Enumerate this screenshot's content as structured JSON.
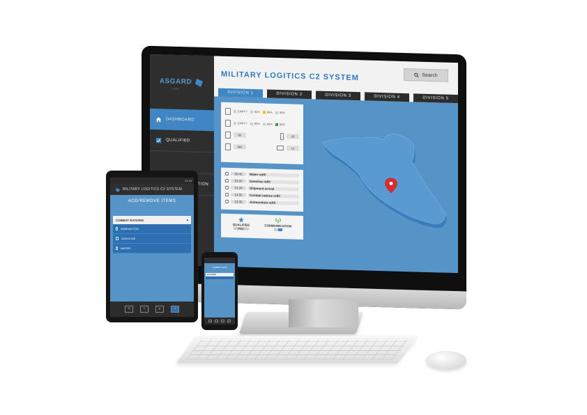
{
  "desktop": {
    "logo": {
      "name": "ASGARD",
      "sub": "LOGI"
    },
    "sidebar": [
      {
        "label": "DASHBOARD",
        "icon": "home-icon",
        "active": true
      },
      {
        "label": "QUALIFIED",
        "icon": "checkbox-icon",
        "active": false
      },
      {
        "label": "",
        "icon": "",
        "active": false
      },
      {
        "label": "ATION",
        "icon": "",
        "active": false
      },
      {
        "label": "",
        "icon": "",
        "active": false
      }
    ],
    "title": "MILITARY LOGITICS C2 SYSTEM",
    "search_label": "Search",
    "tabs": [
      "DIVISION 1",
      "DIVISION 2",
      "DIVISION 3",
      "DIVISION 4",
      "DIVISION 5"
    ],
    "supply": {
      "row1": {
        "empty": "EMPTY",
        "a": "50%",
        "b": "80%",
        "c": "90%"
      },
      "row2": {
        "empty": "EMPTY",
        "a": "90%",
        "b": "90%",
        "c": "80%"
      },
      "row3": {
        "left": "90",
        "right": "25"
      },
      "row4": {
        "left": "682",
        "right": "12"
      }
    },
    "events": [
      {
        "time": "20:45",
        "label": "Water refill"
      },
      {
        "time": "15:20",
        "label": "Gasoline refill"
      },
      {
        "time": "15:20",
        "label": "Shipment arrival"
      },
      {
        "time": "14:35",
        "label": "Combat rations refill"
      },
      {
        "time": "12:35",
        "label": "Ammunition refill"
      }
    ],
    "status": {
      "qualified_label": "QUALIFIED",
      "qualified_value": "FULL",
      "communication_label": "COMMUNICATION"
    },
    "colors": {
      "accent": "#3f86c4",
      "map_bg": "#5694c8",
      "pin": "#d32f2f"
    }
  },
  "tablet": {
    "status_time": "21:34",
    "app_title": "MILITARY LOGITICS C2 SYSTEM",
    "heading": "AOD/REMOVE ITEMS",
    "section": "COBBAT RATIONS",
    "items": [
      "AMMUNITION",
      "GASOLINE",
      "WATER"
    ],
    "footer_buttons": [
      "+",
      "~",
      "search-icon",
      "box-icon"
    ]
  },
  "phone": {
    "heading": "COMBAT ITEMS",
    "section": "Ammunition"
  }
}
